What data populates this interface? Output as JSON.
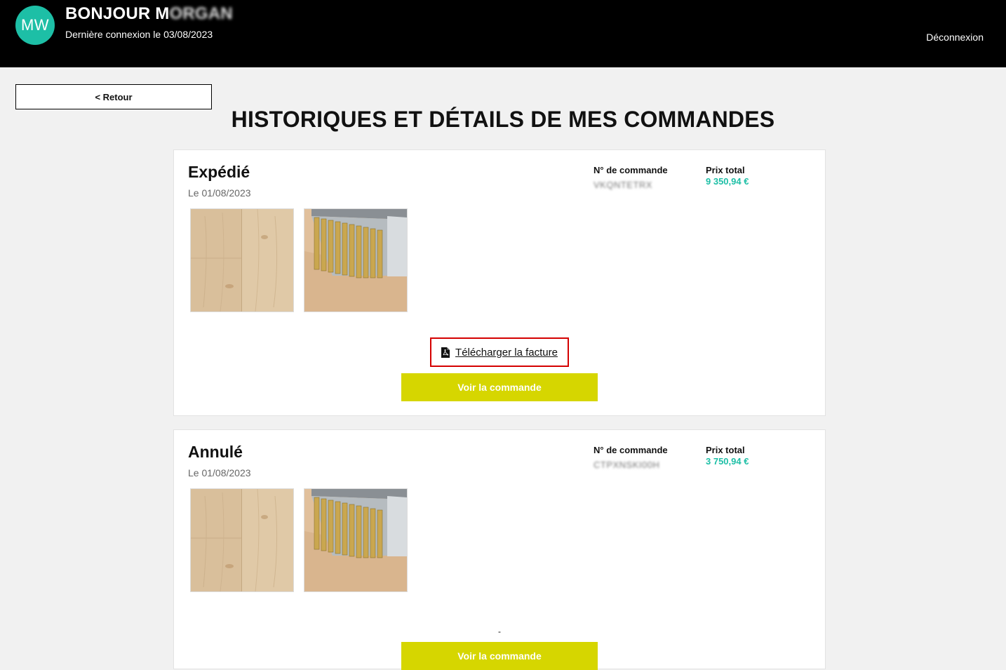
{
  "header": {
    "avatar_initials": "MW",
    "greeting": "BONJOUR M",
    "greeting_obscured": "ORGAN",
    "last_login": "Dernière connexion le 03/08/2023",
    "logout": "Déconnexion"
  },
  "back_button": "< Retour",
  "page_title": "HISTORIQUES ET DÉTAILS DE MES COMMANDES",
  "labels": {
    "order_number": "N° de commande",
    "total_price": "Prix total"
  },
  "orders": [
    {
      "status": "Expédié",
      "date": "Le 01/08/2023",
      "order_number": "VKQNTETRX",
      "total_price": "9 350,94 €",
      "invoice_link": "Télécharger la facture",
      "view_button": "Voir la commande"
    },
    {
      "status": "Annulé",
      "date": "Le 01/08/2023",
      "order_number": "CTPXNSKI00H",
      "total_price": "3 750,94 €",
      "separator": "-",
      "view_button": "Voir la commande"
    }
  ],
  "colors": {
    "accent_teal": "#1dbfa6",
    "button_lime": "#d6d600",
    "highlight_red": "#d40000"
  },
  "icons": [
    "pdf-icon"
  ]
}
